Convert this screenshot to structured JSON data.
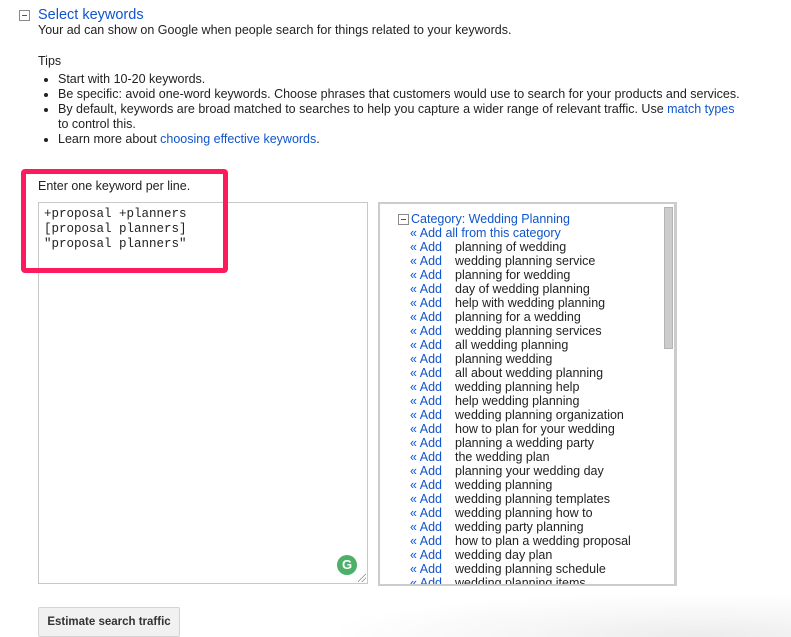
{
  "section": {
    "title": "Select keywords",
    "description": "Your ad can show on Google when people search for things related to your keywords."
  },
  "tips": {
    "title": "Tips",
    "items": [
      {
        "text": "Start with 10-20 keywords."
      },
      {
        "text": "Be specific: avoid one-word keywords. Choose phrases that customers would use to search for your products and services."
      },
      {
        "before": "By default, keywords are broad matched to searches to help you capture a wider range of relevant traffic. Use ",
        "link": "match types",
        "after": " to control this."
      },
      {
        "before": "Learn more about ",
        "link": "choosing effective keywords",
        "after": "."
      }
    ]
  },
  "keyword_entry": {
    "label": "Enter one keyword per line.",
    "value": "+proposal +planners\n[proposal planners]\n\"proposal planners\""
  },
  "grammarly_icon": "G",
  "suggestions": {
    "category_title": "Category: Wedding Planning",
    "add_all_label": "« Add all from this category",
    "add_label": "« Add",
    "keywords": [
      "planning of wedding",
      "wedding planning service",
      "planning for wedding",
      "day of wedding planning",
      "help with wedding planning",
      "planning for a wedding",
      "wedding planning services",
      "all wedding planning",
      "planning wedding",
      "all about wedding planning",
      "wedding planning help",
      "help wedding planning",
      "wedding planning organization",
      "how to plan for your wedding",
      "planning a wedding party",
      "the wedding plan",
      "planning your wedding day",
      "wedding planning",
      "wedding planning templates",
      "wedding planning how to",
      "wedding party planning",
      "how to plan a wedding proposal",
      "wedding day plan",
      "wedding planning schedule",
      "wedding planning items"
    ]
  },
  "estimate_button": "Estimate search traffic",
  "colors": {
    "link": "#1155cc",
    "highlight": "#ff1a5e",
    "grammarly": "#4caf6a"
  }
}
